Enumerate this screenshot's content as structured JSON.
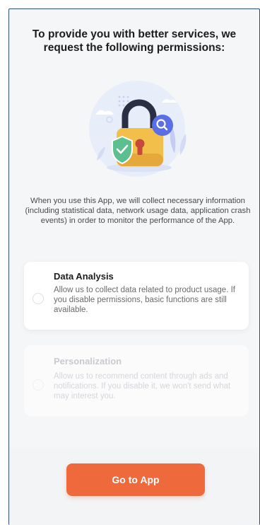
{
  "dialog": {
    "title": "To provide you with better services, we request the following permissions:",
    "description": "When you use this App, we will collect necessary information (including statistical data, network usage data, application crash events) in order to monitor the performance of the App."
  },
  "permissions": [
    {
      "title": "Data Analysis",
      "text": "Allow us to collect data related to product usage. If you disable permissions, basic functions are still available.",
      "selected": false
    },
    {
      "title": "Personalization",
      "text": "Allow us to recommend content through ads and notifications. If you disable it, we won't send what may interest you.",
      "selected": false
    }
  ],
  "actions": {
    "go_to_app_label": "Go to App"
  },
  "colors": {
    "accent": "#ee6a3c",
    "lock_body": "#f2c04a",
    "shield": "#5cbf8f",
    "magnifier": "#5a6ee6",
    "border": "#2f4a8a"
  },
  "icons": {
    "illustration": "padlock-illustration",
    "shield": "shield-check-icon",
    "magnifier": "search-icon"
  }
}
